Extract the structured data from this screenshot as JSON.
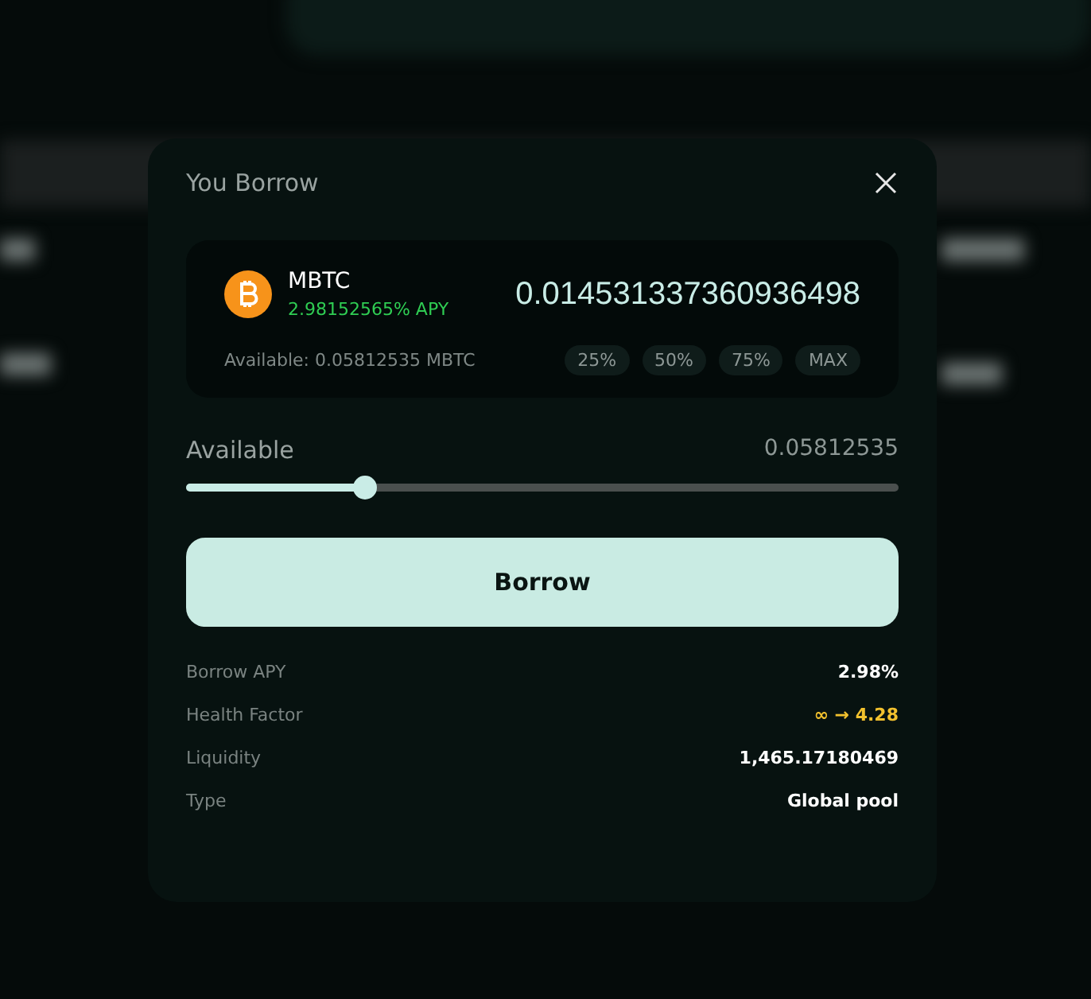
{
  "modal": {
    "title": "You Borrow"
  },
  "asset": {
    "symbol": "MBTC",
    "apy": "2.98152565% APY",
    "amount": "0.014531337360936498",
    "available": "Available: 0.05812535 MBTC"
  },
  "presets": [
    {
      "label": "25%"
    },
    {
      "label": "50%"
    },
    {
      "label": "75%"
    },
    {
      "label": "MAX"
    }
  ],
  "slider": {
    "label": "Available",
    "value": "0.05812535",
    "level": 0.25
  },
  "button": {
    "label": "Borrow"
  },
  "details": [
    {
      "label": "Borrow APY",
      "value": "2.98%",
      "kind": "plain"
    },
    {
      "label": "Health Factor",
      "value": "∞ → 4.28",
      "kind": "warning"
    },
    {
      "label": "Liquidity",
      "value": "1,465.17180469",
      "kind": "plain"
    },
    {
      "label": "Type",
      "value": "Global pool",
      "kind": "plain"
    }
  ]
}
